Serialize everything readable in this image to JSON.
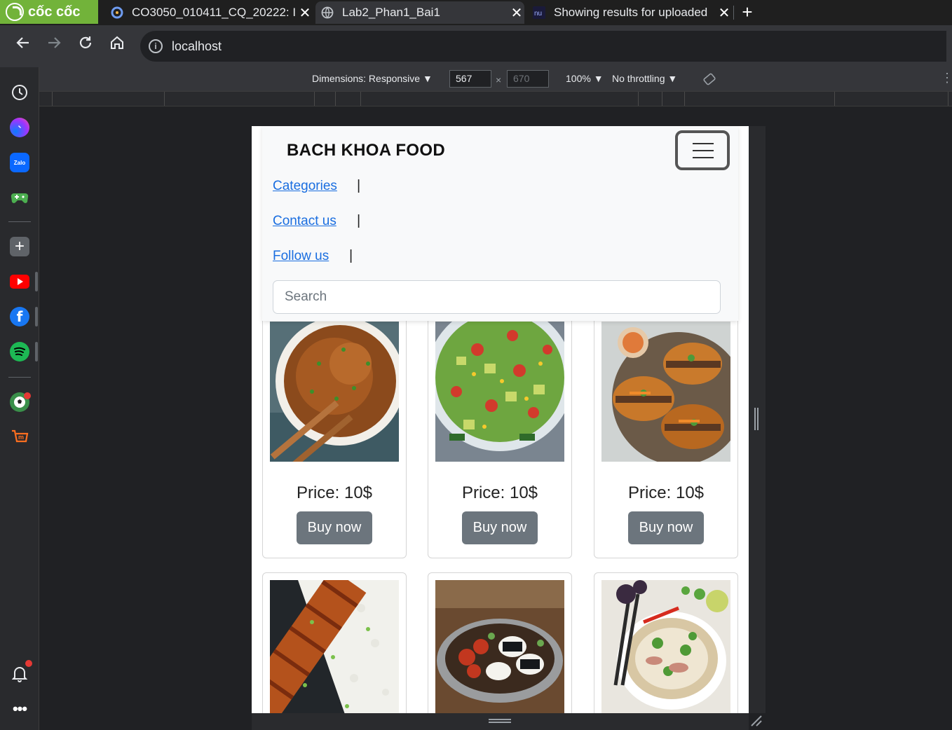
{
  "browser": {
    "brand_name": "cốc cốc",
    "tabs": [
      {
        "title": "CO3050_010411_CQ_20222: I",
        "active": false
      },
      {
        "title": "Lab2_Phan1_Bai1",
        "active": true
      },
      {
        "title": "Showing results for uploaded",
        "active": false
      }
    ],
    "new_tab_symbol": "+",
    "close_symbol": "✕",
    "url": "localhost"
  },
  "devtools": {
    "dimensions_label": "Dimensions: Responsive ▼",
    "width_value": "567",
    "height_value": "670",
    "times": "×",
    "zoom": "100% ▼",
    "throttling": "No throttling ▼"
  },
  "page": {
    "brand": "BACH KHOA FOOD",
    "nav_links": [
      {
        "label": "Categories ",
        "sep": "|"
      },
      {
        "label": "Contact us ",
        "sep": "|"
      },
      {
        "label": "Follow us ",
        "sep": "|"
      }
    ],
    "search_placeholder": "Search",
    "products": [
      {
        "price": "Price: 10$",
        "button": "Buy now",
        "image": "noodles"
      },
      {
        "price": "Price: 10$",
        "button": "Buy now",
        "image": "avocado-salad"
      },
      {
        "price": "Price: 10$",
        "button": "Buy now",
        "image": "banh-mi"
      },
      {
        "image": "chicken-rice"
      },
      {
        "image": "bento-box"
      },
      {
        "image": "pho"
      }
    ]
  }
}
